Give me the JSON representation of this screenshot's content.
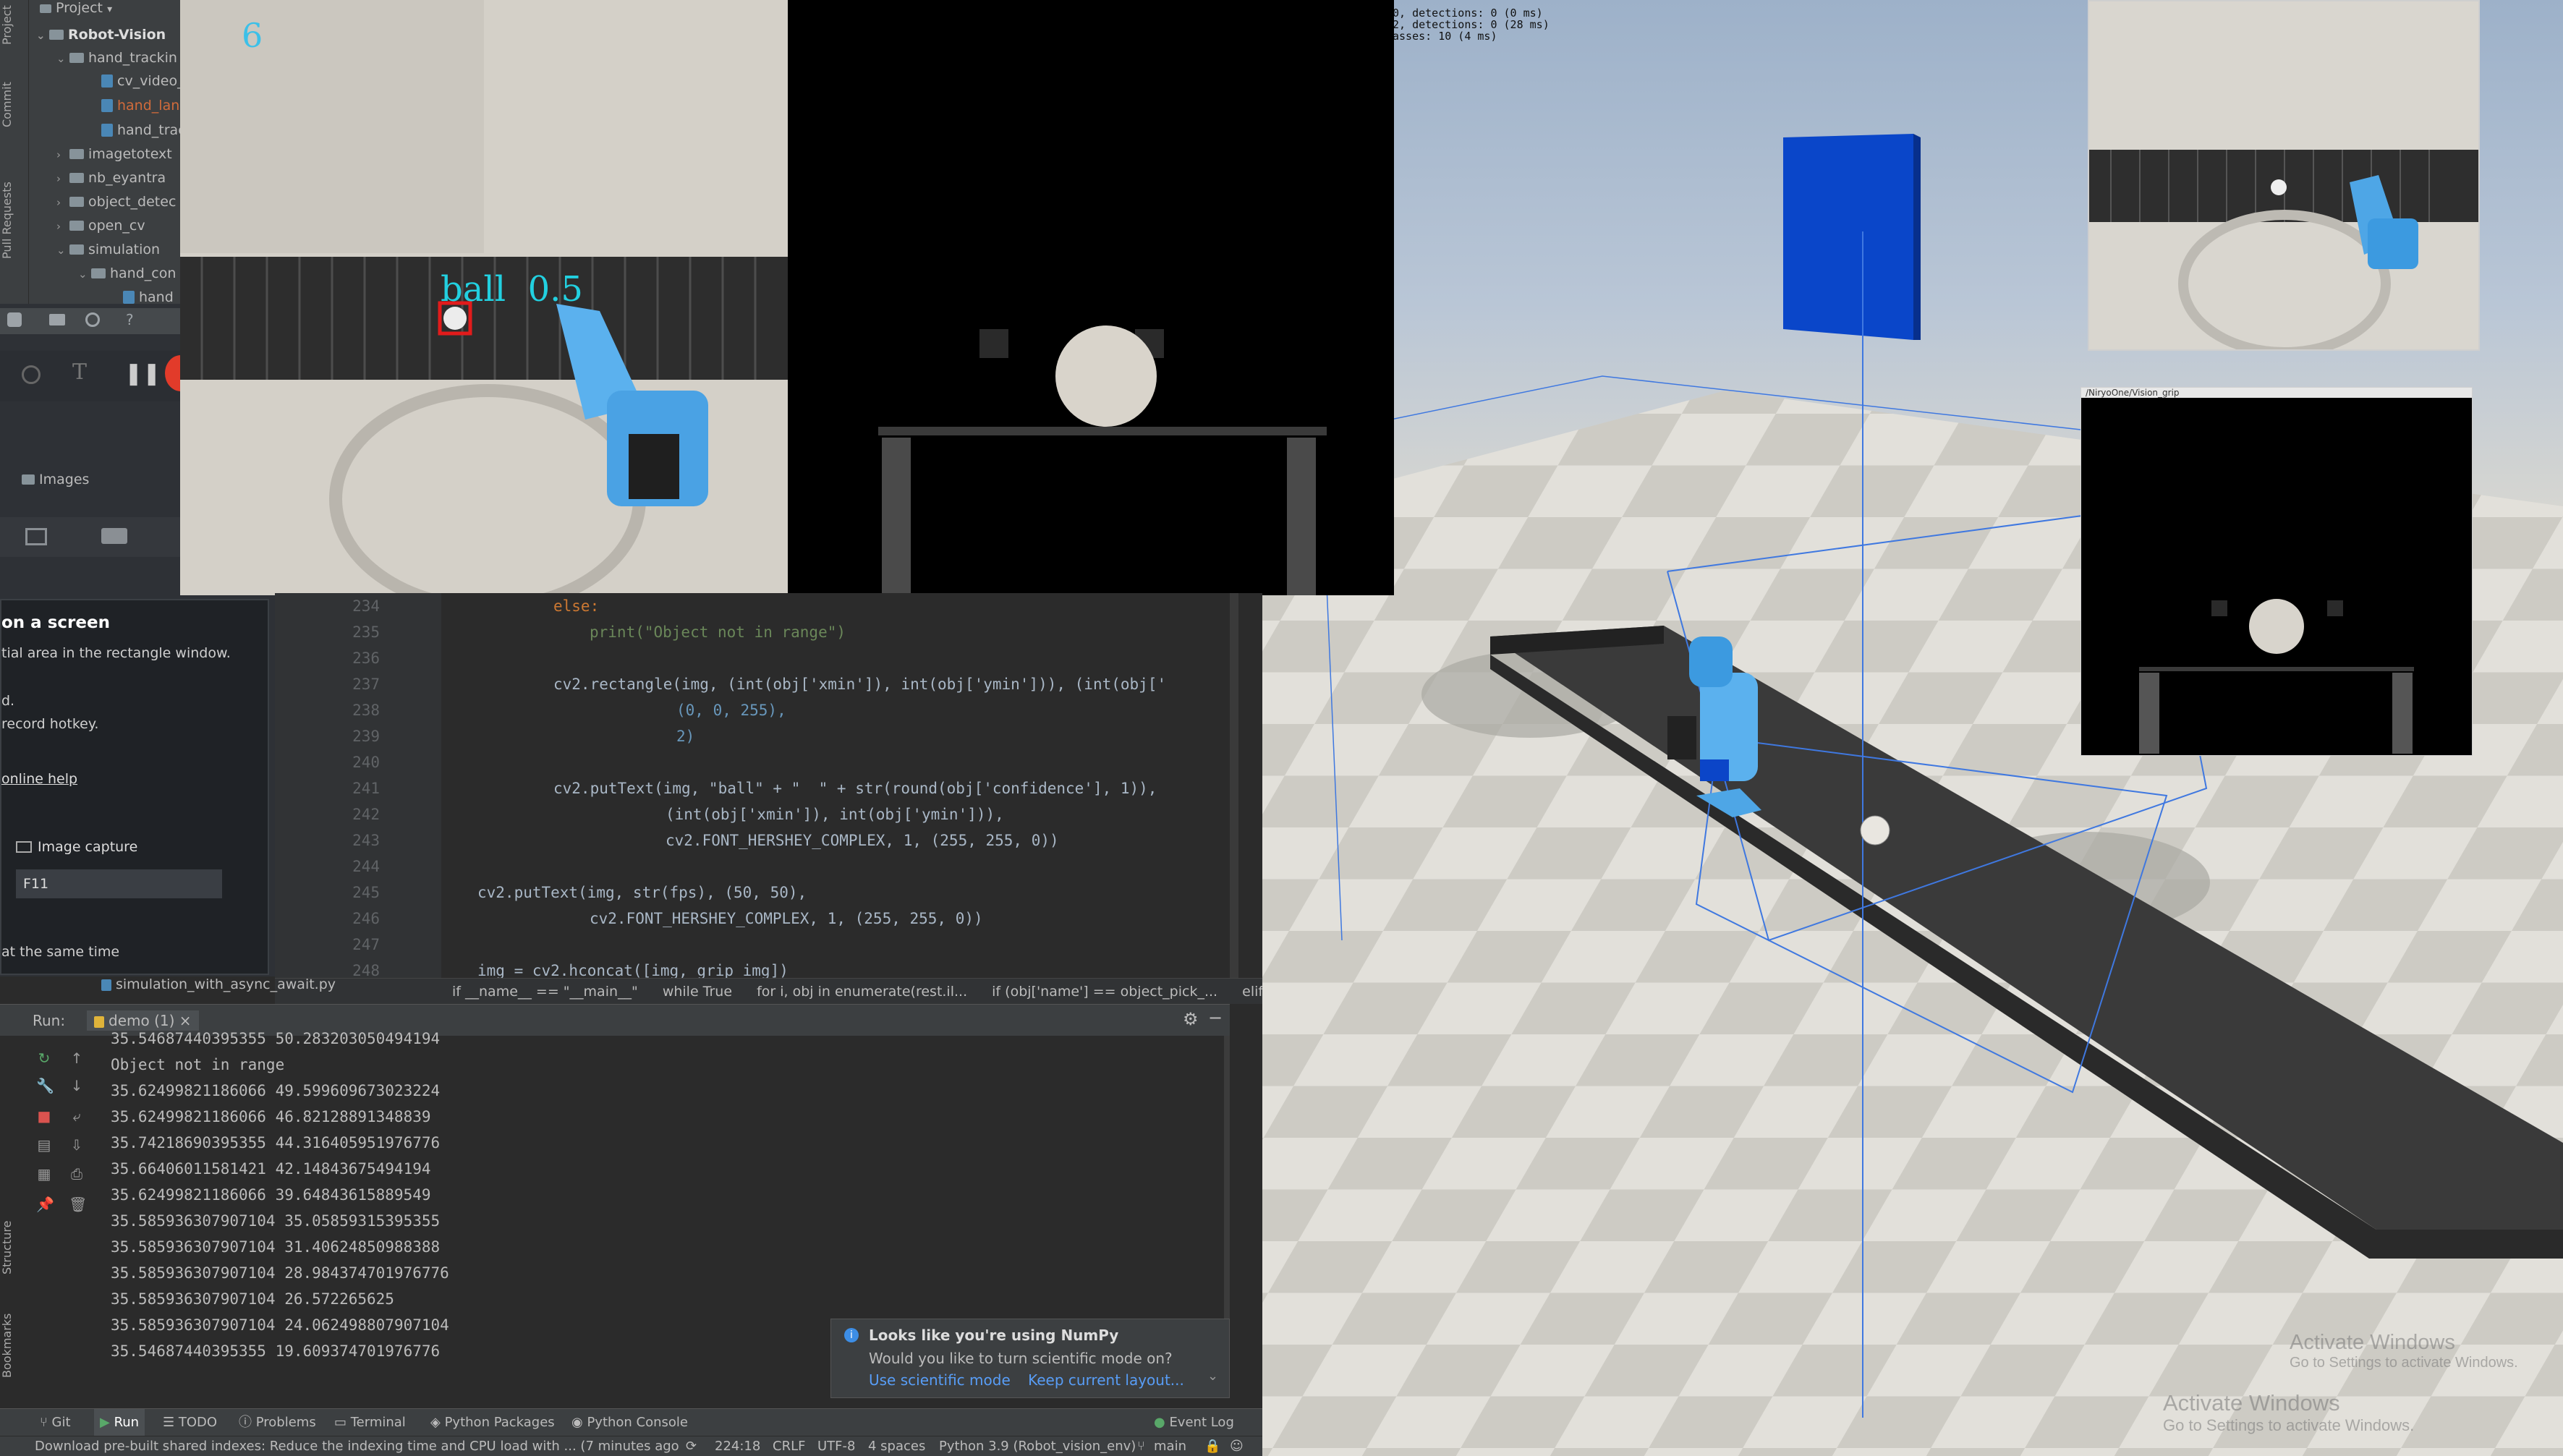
{
  "sim_overlay": {
    "lines": [
      "0, detections: 0 (0 ms)",
      "2, detections: 0 (28 ms)",
      "asses: 10 (4 ms)"
    ]
  },
  "watermark": {
    "line1": "Activate Windows",
    "line2": "Go to Settings to activate Windows."
  },
  "camera_top": {
    "fps": "6",
    "detection_label": "ball  0.5"
  },
  "vision_grip_window": {
    "title": "/NiryoOne/Vision_grip"
  },
  "project_panel": {
    "header": "Project",
    "side_tabs": [
      "Project",
      "Commit",
      "Pull Requests"
    ],
    "tree": [
      {
        "label": "Robot-Vision",
        "kind": "folder",
        "open": true
      },
      {
        "label": "hand_trackin",
        "kind": "folder",
        "open": true
      },
      {
        "label": "cv_video_",
        "kind": "file"
      },
      {
        "label": "hand_lan",
        "kind": "file"
      },
      {
        "label": "hand_trac",
        "kind": "file"
      },
      {
        "label": "imagetotext",
        "kind": "folder",
        "open": false
      },
      {
        "label": "nb_eyantra",
        "kind": "folder",
        "open": false
      },
      {
        "label": "object_detec",
        "kind": "folder",
        "open": false
      },
      {
        "label": "open_cv",
        "kind": "folder",
        "open": false
      },
      {
        "label": "simulation",
        "kind": "folder",
        "open": true
      },
      {
        "label": "hand_con",
        "kind": "folder",
        "open": true
      },
      {
        "label": "hand_",
        "kind": "file"
      }
    ],
    "bottom_file": "simulation_with_async_await.py"
  },
  "recorder_panel": {
    "images_label": "Images",
    "heading": "on a screen",
    "desc": "tial area in the rectangle window.",
    "d_line": "d.",
    "hotkey_line": "record hotkey.",
    "online_help": "online help",
    "image_capture_label": "Image capture",
    "hotkey_value": "F11",
    "same_time": "at the same time"
  },
  "code": {
    "lines": [
      {
        "n": "234",
        "text": "else:"
      },
      {
        "n": "235",
        "text": "print(\"Object not in range\")"
      },
      {
        "n": "236",
        "text": ""
      },
      {
        "n": "237",
        "text": "cv2.rectangle(img, (int(obj['xmin']), int(obj['ymin'])), (int(obj['"
      },
      {
        "n": "238",
        "text": "(0, 0, 255),"
      },
      {
        "n": "239",
        "text": "2)"
      },
      {
        "n": "240",
        "text": ""
      },
      {
        "n": "241",
        "text": "cv2.putText(img, \"ball\" + \"  \" + str(round(obj['confidence'], 1)),"
      },
      {
        "n": "242",
        "text": "(int(obj['xmin']), int(obj['ymin'])),"
      },
      {
        "n": "243",
        "text": "cv2.FONT_HERSHEY_COMPLEX, 1, (255, 255, 0))"
      },
      {
        "n": "244",
        "text": ""
      },
      {
        "n": "245",
        "text": "cv2.putText(img, str(fps), (50, 50),"
      },
      {
        "n": "246",
        "text": "cv2.FONT_HERSHEY_COMPLEX, 1, (255, 255, 0))"
      },
      {
        "n": "247",
        "text": ""
      },
      {
        "n": "248",
        "text": "img = cv2.hconcat([img, grip_img])"
      }
    ]
  },
  "breadcrumb": [
    "if __name__ == \"__main__\"",
    "while True",
    "for i, obj in enumerate(rest.il...",
    "if (obj['name'] == object_pick_...",
    "elif (xposit"
  ],
  "run": {
    "label": "Run:",
    "config": "demo (1)",
    "output": [
      "35.54687440395355 50.283203050494194",
      "Object not in range",
      "35.62499821186066 49.599609673023224",
      "35.62499821186066 46.82128891348839",
      "35.74218690395355 44.316405951976776",
      "35.66406011581421 42.14843675494194",
      "35.62499821186066 39.64843615889549",
      "35.585936307907104 35.05859315395355",
      "35.585936307907104 31.40624850988388",
      "35.585936307907104 28.984374701976776",
      "35.585936307907104 26.572265625",
      "35.585936307907104 24.062498807907104",
      "35.54687440395355 19.609374701976776"
    ]
  },
  "numpy_popup": {
    "title": "Looks like you're using NumPy",
    "body": "Would you like to turn scientific mode on?",
    "action1": "Use scientific mode",
    "action2": "Keep current layout..."
  },
  "tool_tabs": [
    "Git",
    "Run",
    "TODO",
    "Problems",
    "Terminal",
    "Python Packages",
    "Python Console",
    "Event Log"
  ],
  "left_vertical_tabs": [
    "Structure",
    "Bookmarks"
  ],
  "status": {
    "message": "Download pre-built shared indexes: Reduce the indexing time and CPU load with ... (7 minutes ago",
    "position": "224:18",
    "line_sep": "CRLF",
    "encoding": "UTF-8",
    "indent": "4 spaces",
    "interpreter": "Python 3.9 (Robot_vision_env)",
    "branch": "main"
  }
}
